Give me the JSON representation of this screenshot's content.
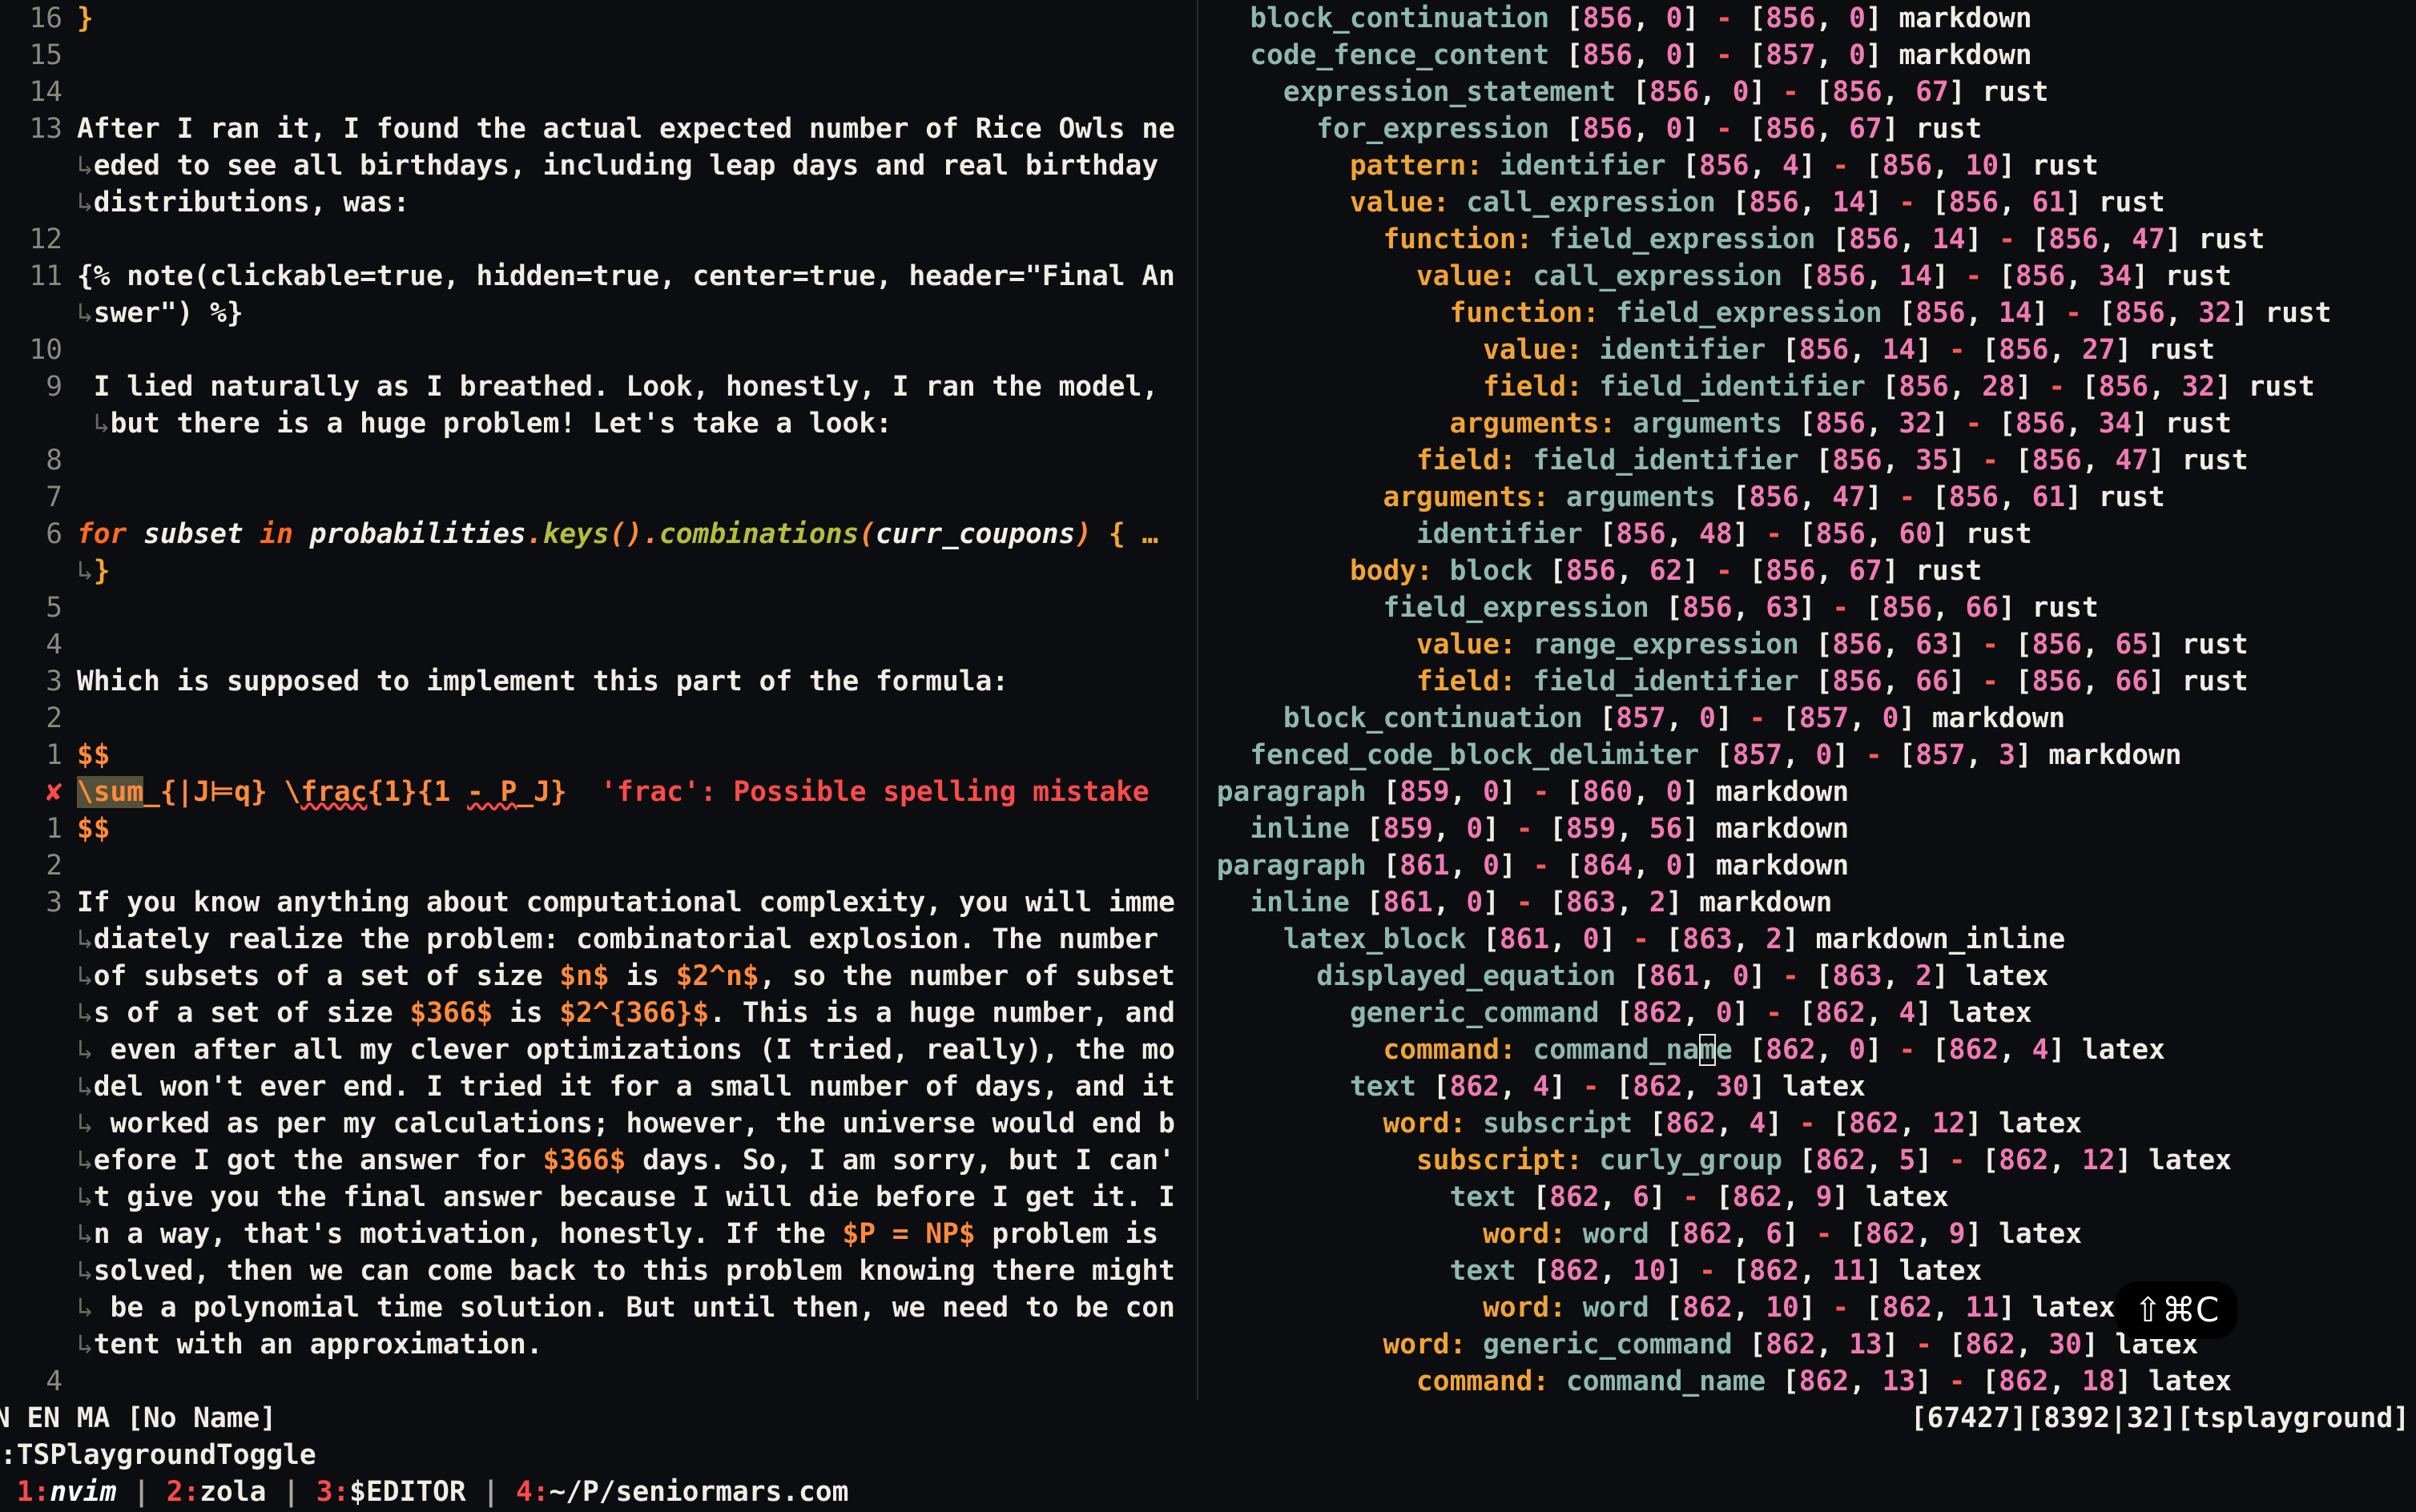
{
  "editor": {
    "left": [
      {
        "ln": "16",
        "segs": [
          {
            "c": "br",
            "t": "}"
          }
        ]
      },
      {
        "ln": "15",
        "segs": []
      },
      {
        "ln": "14",
        "segs": []
      },
      {
        "ln": "13",
        "segs": [
          {
            "c": "txt",
            "t": "After I ran it, I found the actual expected number of Rice Owls ne"
          }
        ]
      },
      {
        "ln": "",
        "wrap": true,
        "segs": [
          {
            "c": "txt",
            "t": "eded to see all birthdays, including leap days and real birthday"
          }
        ]
      },
      {
        "ln": "",
        "wrap": true,
        "segs": [
          {
            "c": "txt",
            "t": "distributions, was:"
          }
        ]
      },
      {
        "ln": "12",
        "segs": []
      },
      {
        "ln": "11",
        "segs": [
          {
            "c": "txt",
            "t": "{% note(clickable=true, hidden=true, center=true, header=\"Final An"
          }
        ]
      },
      {
        "ln": "",
        "wrap": true,
        "segs": [
          {
            "c": "txt",
            "t": "swer\") %}"
          }
        ]
      },
      {
        "ln": "10",
        "segs": []
      },
      {
        "ln": "9",
        "segs": [
          {
            "c": "txt",
            "t": " I lied naturally as I breathed. Look, honestly, I ran the model,"
          }
        ]
      },
      {
        "ln": "",
        "wrap": true,
        "indent": " ",
        "segs": [
          {
            "c": "txt",
            "t": "but there is a huge problem! Let's take a look:"
          }
        ]
      },
      {
        "ln": "8",
        "segs": []
      },
      {
        "ln": "7",
        "segs": []
      },
      {
        "ln": "6",
        "segs": [
          {
            "c": "kw",
            "t": "for"
          },
          {
            "c": "it",
            "t": " subset "
          },
          {
            "c": "kw",
            "t": "in"
          },
          {
            "c": "it",
            "t": " probabilities"
          },
          {
            "c": "pu",
            "t": "."
          },
          {
            "c": "fn",
            "t": "keys"
          },
          {
            "c": "pu",
            "t": "()."
          },
          {
            "c": "fn",
            "t": "combinations"
          },
          {
            "c": "pu",
            "t": "("
          },
          {
            "c": "it",
            "t": "curr_coupons"
          },
          {
            "c": "pu",
            "t": ")"
          },
          {
            "c": "br",
            "t": " { …"
          }
        ]
      },
      {
        "ln": "",
        "wrap": true,
        "segs": [
          {
            "c": "br",
            "t": "}"
          }
        ]
      },
      {
        "ln": "5",
        "segs": []
      },
      {
        "ln": "4",
        "segs": []
      },
      {
        "ln": "3",
        "segs": [
          {
            "c": "txt",
            "t": "Which is supposed to implement this part of the formula:"
          }
        ]
      },
      {
        "ln": "2",
        "segs": []
      },
      {
        "ln": "1",
        "segs": [
          {
            "c": "math",
            "t": "$$"
          }
        ]
      },
      {
        "ln": "✘",
        "err": true,
        "segs": [
          {
            "c": "math hl",
            "t": "\\sum"
          },
          {
            "c": "math",
            "t": "_{|J⊨q} \\"
          },
          {
            "c": "math squig",
            "t": "frac"
          },
          {
            "c": "math",
            "t": "{1}{1 "
          },
          {
            "c": "math squig",
            "t": "- P"
          },
          {
            "c": "math",
            "t": "_J}  "
          },
          {
            "c": "diag",
            "t": "'frac': Possible spelling mistake"
          }
        ]
      },
      {
        "ln": "1",
        "segs": [
          {
            "c": "math",
            "t": "$$"
          }
        ]
      },
      {
        "ln": "2",
        "segs": []
      },
      {
        "ln": "3",
        "segs": [
          {
            "c": "txt",
            "t": "If you know anything about computational complexity, you will imme"
          }
        ]
      },
      {
        "ln": "",
        "wrap": true,
        "segs": [
          {
            "c": "txt",
            "t": "diately realize the problem: combinatorial explosion. The number"
          }
        ]
      },
      {
        "ln": "",
        "wrap": true,
        "segs": [
          {
            "c": "txt",
            "t": "of subsets of a set of size "
          },
          {
            "c": "math",
            "t": "$n$"
          },
          {
            "c": "txt",
            "t": " is "
          },
          {
            "c": "math",
            "t": "$2^n$"
          },
          {
            "c": "txt",
            "t": ", so the number of subset"
          }
        ]
      },
      {
        "ln": "",
        "wrap": true,
        "segs": [
          {
            "c": "txt",
            "t": "s of a set of size "
          },
          {
            "c": "math",
            "t": "$366$"
          },
          {
            "c": "txt",
            "t": " is "
          },
          {
            "c": "math",
            "t": "$2^{366}$"
          },
          {
            "c": "txt",
            "t": ". This is a huge number, and"
          }
        ]
      },
      {
        "ln": "",
        "wrap": true,
        "segs": [
          {
            "c": "txt",
            "t": " even after all my clever optimizations (I tried, really), the mo"
          }
        ]
      },
      {
        "ln": "",
        "wrap": true,
        "segs": [
          {
            "c": "txt",
            "t": "del won't ever end. I tried it for a small number of days, and it"
          }
        ]
      },
      {
        "ln": "",
        "wrap": true,
        "segs": [
          {
            "c": "txt",
            "t": " worked as per my calculations; however, the universe would end b"
          }
        ]
      },
      {
        "ln": "",
        "wrap": true,
        "segs": [
          {
            "c": "txt",
            "t": "efore I got the answer for "
          },
          {
            "c": "math",
            "t": "$366$"
          },
          {
            "c": "txt",
            "t": " days. So, I am sorry, but I can'"
          }
        ]
      },
      {
        "ln": "",
        "wrap": true,
        "segs": [
          {
            "c": "txt",
            "t": "t give you the final answer because I will die before I get it. I"
          }
        ]
      },
      {
        "ln": "",
        "wrap": true,
        "segs": [
          {
            "c": "txt",
            "t": "n a way, that's motivation, honestly. If the "
          },
          {
            "c": "math",
            "t": "$P = NP$"
          },
          {
            "c": "txt",
            "t": " problem is"
          }
        ]
      },
      {
        "ln": "",
        "wrap": true,
        "segs": [
          {
            "c": "txt",
            "t": "solved, then we can come back to this problem knowing there might"
          }
        ]
      },
      {
        "ln": "",
        "wrap": true,
        "segs": [
          {
            "c": "txt",
            "t": " be a polynomial time solution. But until then, we need to be con"
          }
        ]
      },
      {
        "ln": "",
        "wrap": true,
        "segs": [
          {
            "c": "txt",
            "t": "tent with an approximation."
          }
        ]
      },
      {
        "ln": "4",
        "segs": []
      }
    ],
    "tree": [
      {
        "d": 1,
        "n": "block_continuation",
        "r": [
          "856",
          "0",
          "856",
          "0"
        ],
        "l": "markdown"
      },
      {
        "d": 1,
        "n": "code_fence_content",
        "r": [
          "856",
          "0",
          "857",
          "0"
        ],
        "l": "markdown"
      },
      {
        "d": 2,
        "n": "expression_statement",
        "r": [
          "856",
          "0",
          "856",
          "67"
        ],
        "l": "rust"
      },
      {
        "d": 3,
        "n": "for_expression",
        "r": [
          "856",
          "0",
          "856",
          "67"
        ],
        "l": "rust"
      },
      {
        "d": 4,
        "f": "pattern:",
        "n": "identifier",
        "r": [
          "856",
          "4",
          "856",
          "10"
        ],
        "l": "rust"
      },
      {
        "d": 4,
        "f": "value:",
        "n": "call_expression",
        "r": [
          "856",
          "14",
          "856",
          "61"
        ],
        "l": "rust"
      },
      {
        "d": 5,
        "f": "function:",
        "n": "field_expression",
        "r": [
          "856",
          "14",
          "856",
          "47"
        ],
        "l": "rust"
      },
      {
        "d": 6,
        "f": "value:",
        "n": "call_expression",
        "r": [
          "856",
          "14",
          "856",
          "34"
        ],
        "l": "rust"
      },
      {
        "d": 7,
        "f": "function:",
        "n": "field_expression",
        "r": [
          "856",
          "14",
          "856",
          "32"
        ],
        "l": "rust"
      },
      {
        "d": 8,
        "f": "value:",
        "n": "identifier",
        "r": [
          "856",
          "14",
          "856",
          "27"
        ],
        "l": "rust"
      },
      {
        "d": 8,
        "f": "field:",
        "n": "field_identifier",
        "r": [
          "856",
          "28",
          "856",
          "32"
        ],
        "l": "rust"
      },
      {
        "d": 7,
        "f": "arguments:",
        "n": "arguments",
        "r": [
          "856",
          "32",
          "856",
          "34"
        ],
        "l": "rust"
      },
      {
        "d": 6,
        "f": "field:",
        "n": "field_identifier",
        "r": [
          "856",
          "35",
          "856",
          "47"
        ],
        "l": "rust"
      },
      {
        "d": 5,
        "f": "arguments:",
        "n": "arguments",
        "r": [
          "856",
          "47",
          "856",
          "61"
        ],
        "l": "rust"
      },
      {
        "d": 6,
        "n": "identifier",
        "r": [
          "856",
          "48",
          "856",
          "60"
        ],
        "l": "rust"
      },
      {
        "d": 4,
        "f": "body:",
        "n": "block",
        "r": [
          "856",
          "62",
          "856",
          "67"
        ],
        "l": "rust"
      },
      {
        "d": 5,
        "n": "field_expression",
        "r": [
          "856",
          "63",
          "856",
          "66"
        ],
        "l": "rust"
      },
      {
        "d": 6,
        "f": "value:",
        "n": "range_expression",
        "r": [
          "856",
          "63",
          "856",
          "65"
        ],
        "l": "rust"
      },
      {
        "d": 6,
        "f": "field:",
        "n": "field_identifier",
        "r": [
          "856",
          "66",
          "856",
          "66"
        ],
        "l": "rust"
      },
      {
        "d": 2,
        "n": "block_continuation",
        "r": [
          "857",
          "0",
          "857",
          "0"
        ],
        "l": "markdown"
      },
      {
        "d": 1,
        "n": "fenced_code_block_delimiter",
        "r": [
          "857",
          "0",
          "857",
          "3"
        ],
        "l": "markdown"
      },
      {
        "d": 0,
        "n": "paragraph",
        "r": [
          "859",
          "0",
          "860",
          "0"
        ],
        "l": "markdown"
      },
      {
        "d": 1,
        "n": "inline",
        "r": [
          "859",
          "0",
          "859",
          "56"
        ],
        "l": "markdown"
      },
      {
        "d": 0,
        "n": "paragraph",
        "r": [
          "861",
          "0",
          "864",
          "0"
        ],
        "l": "markdown"
      },
      {
        "d": 1,
        "n": "inline",
        "r": [
          "861",
          "0",
          "863",
          "2"
        ],
        "l": "markdown"
      },
      {
        "d": 2,
        "n": "latex_block",
        "r": [
          "861",
          "0",
          "863",
          "2"
        ],
        "l": "markdown_inline"
      },
      {
        "d": 3,
        "n": "displayed_equation",
        "r": [
          "861",
          "0",
          "863",
          "2"
        ],
        "l": "latex"
      },
      {
        "d": 4,
        "n": "generic_command",
        "r": [
          "862",
          "0",
          "862",
          "4"
        ],
        "l": "latex"
      },
      {
        "d": 5,
        "f": "command:",
        "n": "command_name",
        "r": [
          "862",
          "0",
          "862",
          "4"
        ],
        "l": "latex",
        "cursor": true
      },
      {
        "d": 4,
        "n": "text",
        "r": [
          "862",
          "4",
          "862",
          "30"
        ],
        "l": "latex"
      },
      {
        "d": 5,
        "f": "word:",
        "n": "subscript",
        "r": [
          "862",
          "4",
          "862",
          "12"
        ],
        "l": "latex"
      },
      {
        "d": 6,
        "f": "subscript:",
        "n": "curly_group",
        "r": [
          "862",
          "5",
          "862",
          "12"
        ],
        "l": "latex"
      },
      {
        "d": 7,
        "n": "text",
        "r": [
          "862",
          "6",
          "862",
          "9"
        ],
        "l": "latex"
      },
      {
        "d": 8,
        "f": "word:",
        "n": "word",
        "r": [
          "862",
          "6",
          "862",
          "9"
        ],
        "l": "latex"
      },
      {
        "d": 7,
        "n": "text",
        "r": [
          "862",
          "10",
          "862",
          "11"
        ],
        "l": "latex"
      },
      {
        "d": 8,
        "f": "word:",
        "n": "word",
        "r": [
          "862",
          "10",
          "862",
          "11"
        ],
        "l": "latex"
      },
      {
        "d": 5,
        "f": "word:",
        "n": "generic_command",
        "r": [
          "862",
          "13",
          "862",
          "30"
        ],
        "l": "latex"
      },
      {
        "d": 6,
        "f": "command:",
        "n": "command_name",
        "r": [
          "862",
          "13",
          "862",
          "18"
        ],
        "l": "latex"
      }
    ]
  },
  "status": {
    "left": "N EN MA [No Name]",
    "right": "[67427][8392|32][tsplayground]"
  },
  "command_line": ":TSPlaygroundToggle",
  "tabs": [
    {
      "num": "1:",
      "label": "nvim",
      "active": true
    },
    {
      "num": "2:",
      "label": "zola",
      "active": false
    },
    {
      "num": "3:",
      "label": "$EDITOR",
      "active": false
    },
    {
      "num": "4:",
      "label": "~/P/seniormars.com",
      "active": false
    }
  ],
  "tab_separator": " | ",
  "keystroke_badge": "⇧⌘C",
  "icons": {
    "wrap_marker": "↳",
    "error_marker": "✘"
  }
}
